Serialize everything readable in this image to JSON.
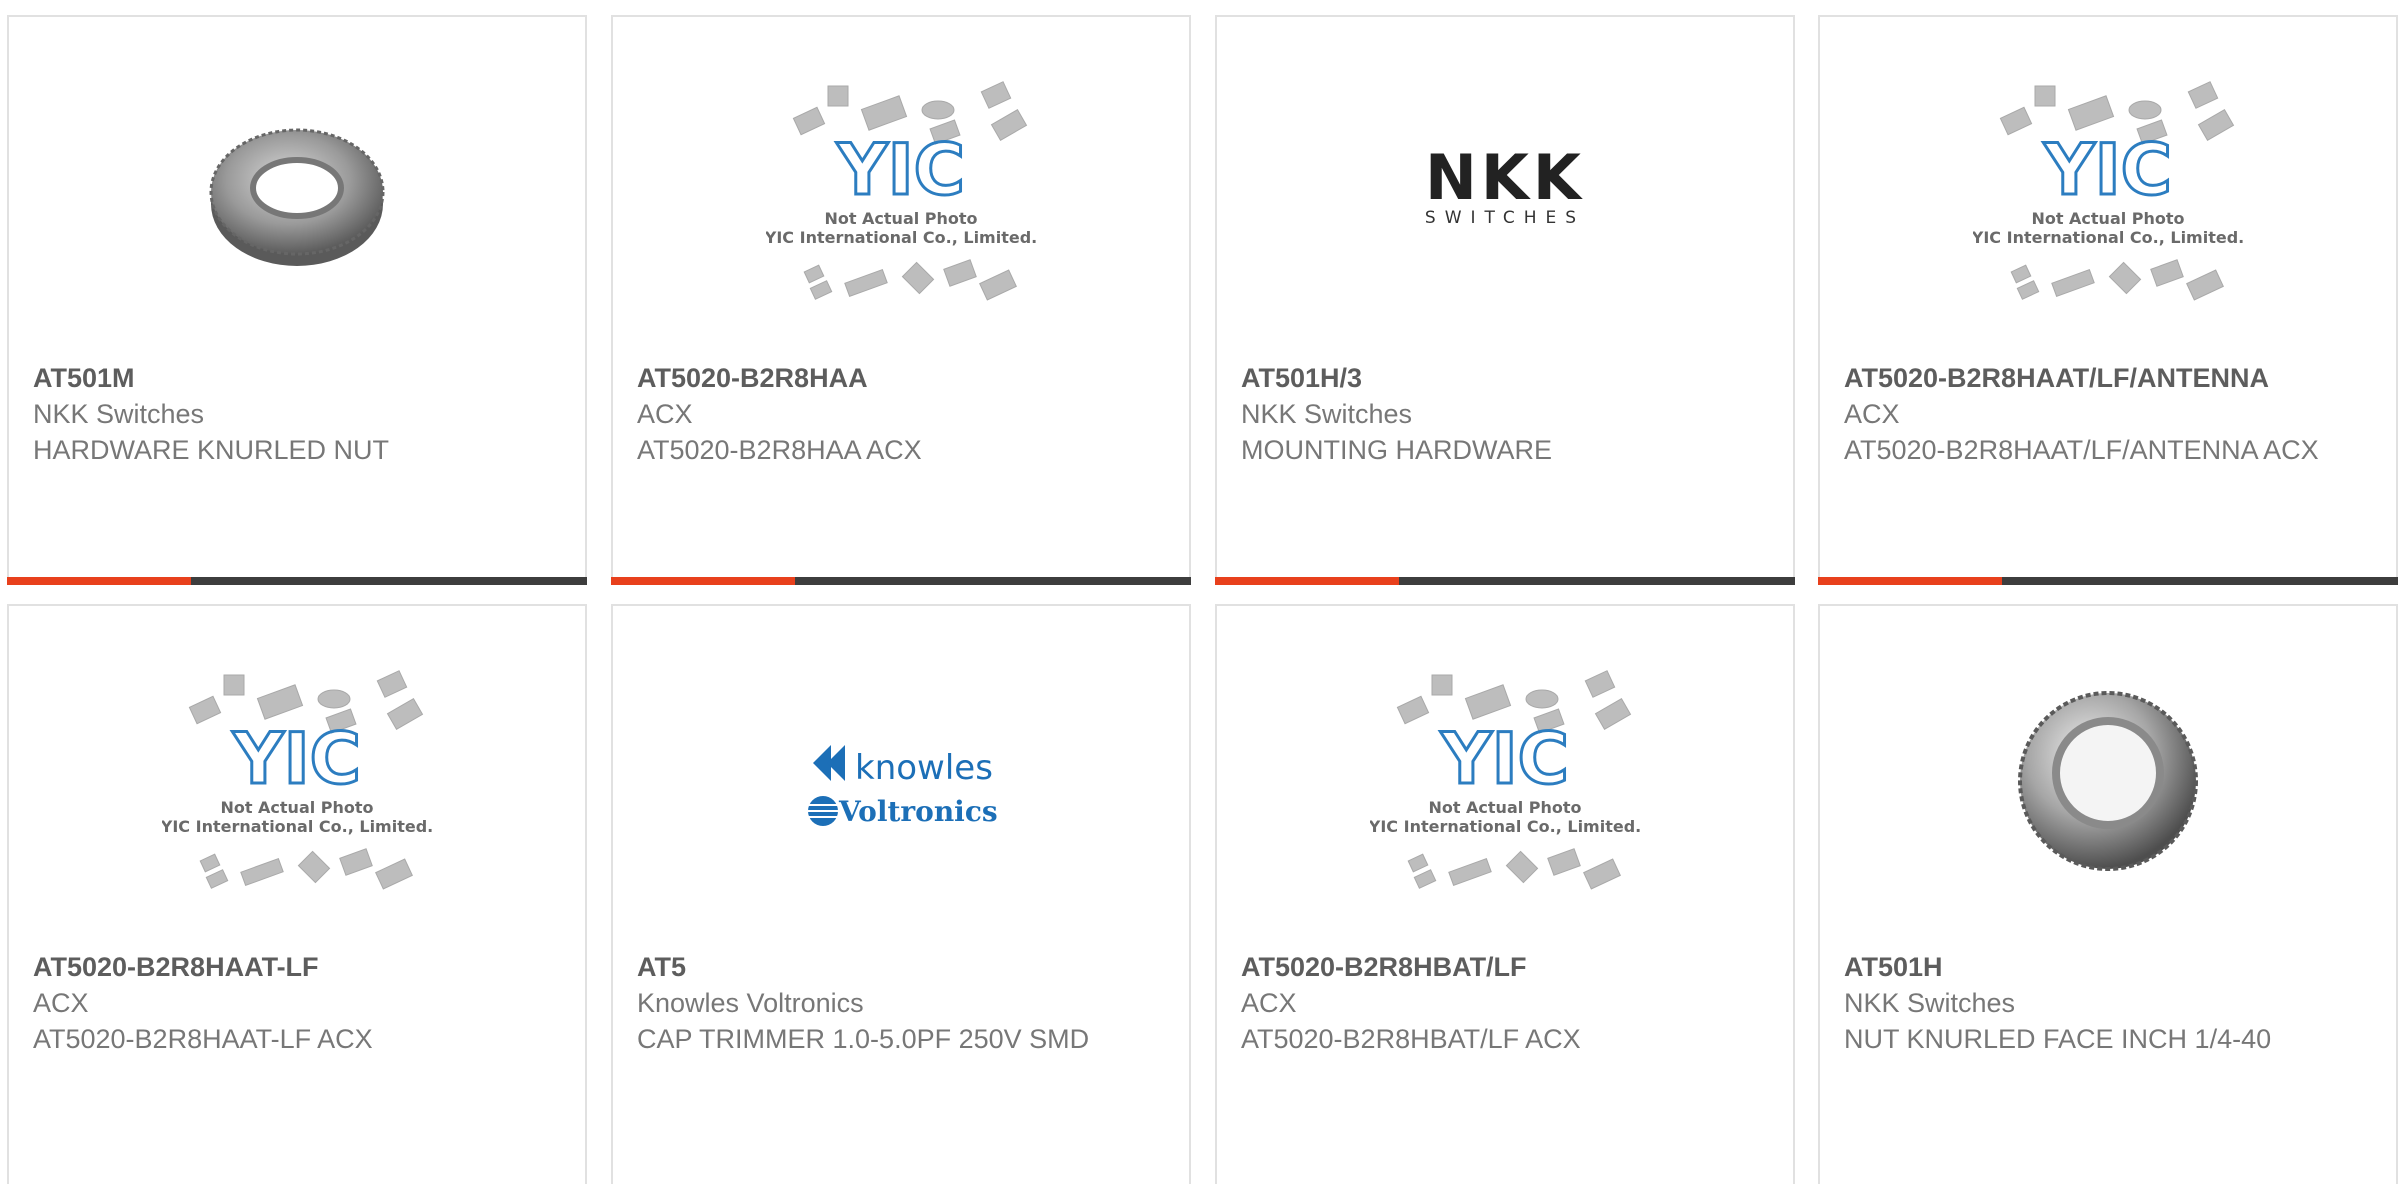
{
  "colors": {
    "accent": "#e8401c",
    "bar": "#3d3d3d",
    "yic_blue": "#2c7dc0",
    "knowles_blue": "#1c6fb7",
    "nkk_red": "#d42027"
  },
  "placeholder": {
    "logo_text": "YIC",
    "line1": "Not Actual Photo",
    "line2": "YIC International Co., Limited."
  },
  "logos": {
    "nkk": {
      "word": "NKK",
      "sub": "SWITCHES"
    },
    "knowles": {
      "word1": "knowles",
      "word2": "Voltronics"
    }
  },
  "products": [
    {
      "part": "AT501M",
      "manufacturer": "NKK Switches",
      "description": "HARDWARE KNURLED NUT",
      "image": "knurled-nut-icon"
    },
    {
      "part": "AT5020-B2R8HAA",
      "manufacturer": "ACX",
      "description": "AT5020-B2R8HAA ACX",
      "image": "yic-placeholder-icon"
    },
    {
      "part": "AT501H/3",
      "manufacturer": "NKK Switches",
      "description": "MOUNTING HARDWARE",
      "image": "nkk-logo-icon"
    },
    {
      "part": "AT5020-B2R8HAAT/LF/ANTENNA",
      "manufacturer": "ACX",
      "description": "AT5020-B2R8HAAT/LF/ANTENNA ACX",
      "image": "yic-placeholder-icon"
    },
    {
      "part": "AT5020-B2R8HAAT-LF",
      "manufacturer": "ACX",
      "description": "AT5020-B2R8HAAT-LF ACX",
      "image": "yic-placeholder-icon"
    },
    {
      "part": "AT5",
      "manufacturer": "Knowles Voltronics",
      "description": "CAP TRIMMER 1.0-5.0PF 250V SMD",
      "image": "knowles-logo-icon"
    },
    {
      "part": "AT5020-B2R8HBAT/LF",
      "manufacturer": "ACX",
      "description": "AT5020-B2R8HBAT/LF ACX",
      "image": "yic-placeholder-icon"
    },
    {
      "part": "AT501H",
      "manufacturer": "NKK Switches",
      "description": "NUT KNURLED FACE INCH 1/4-40",
      "image": "knurled-nut-icon"
    }
  ]
}
